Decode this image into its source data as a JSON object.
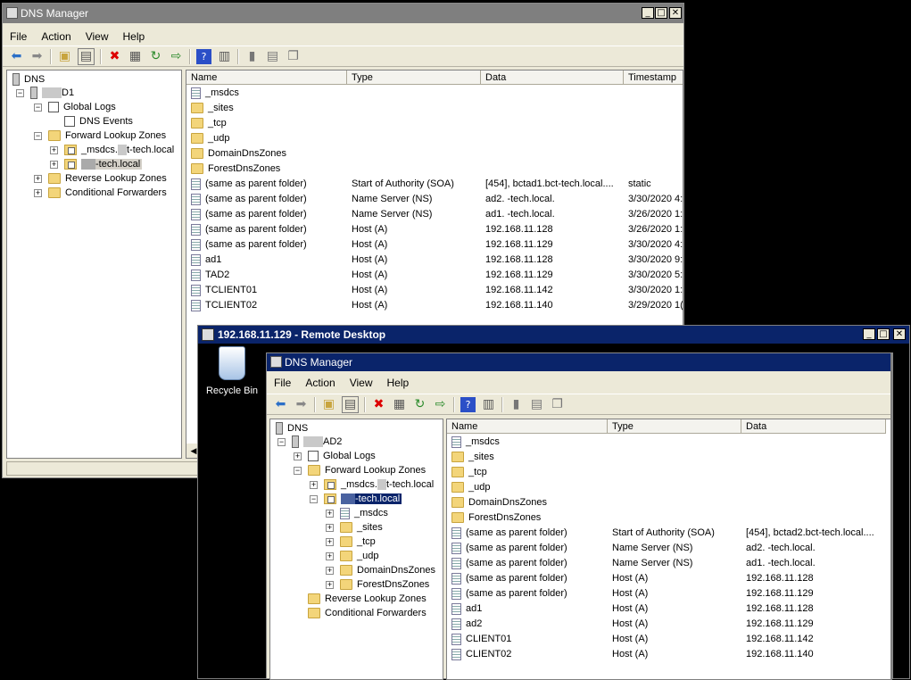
{
  "windowA": {
    "title": "DNS Manager",
    "menu": [
      "File",
      "Action",
      "View",
      "Help"
    ],
    "tree": {
      "root": "DNS",
      "server": "D1",
      "global_logs": "Global Logs",
      "dns_events": "DNS Events",
      "forward": "Forward Lookup Zones",
      "msdcs": "_msdcs.",
      "msdcs_suffix": "t-tech.local",
      "zone": "-tech.local",
      "reverse": "Reverse Lookup Zones",
      "conditional": "Conditional Forwarders"
    },
    "columns": [
      "Name",
      "Type",
      "Data",
      "Timestamp"
    ],
    "rows": [
      {
        "name": "_msdcs",
        "type": "",
        "data": "",
        "ts": "",
        "icon": "doc"
      },
      {
        "name": "_sites",
        "type": "",
        "data": "",
        "ts": "",
        "icon": "folder"
      },
      {
        "name": "_tcp",
        "type": "",
        "data": "",
        "ts": "",
        "icon": "folder"
      },
      {
        "name": "_udp",
        "type": "",
        "data": "",
        "ts": "",
        "icon": "folder"
      },
      {
        "name": "DomainDnsZones",
        "type": "",
        "data": "",
        "ts": "",
        "icon": "folder"
      },
      {
        "name": "ForestDnsZones",
        "type": "",
        "data": "",
        "ts": "",
        "icon": "folder"
      },
      {
        "name": "(same as parent folder)",
        "type": "Start of Authority (SOA)",
        "data": "[454], bctad1.bct-tech.local....",
        "ts": "static",
        "icon": "rec"
      },
      {
        "name": "(same as parent folder)",
        "type": "Name Server (NS)",
        "data": "ad2.    -tech.local.",
        "ts": "3/30/2020 4:",
        "icon": "rec"
      },
      {
        "name": "(same as parent folder)",
        "type": "Name Server (NS)",
        "data": "ad1.    -tech.local.",
        "ts": "3/26/2020 1:",
        "icon": "rec"
      },
      {
        "name": "(same as parent folder)",
        "type": "Host (A)",
        "data": "192.168.11.128",
        "ts": "3/26/2020 1:",
        "icon": "rec"
      },
      {
        "name": "(same as parent folder)",
        "type": "Host (A)",
        "data": "192.168.11.129",
        "ts": "3/30/2020 4:",
        "icon": "rec"
      },
      {
        "name": "ad1",
        "type": "Host (A)",
        "data": "192.168.11.128",
        "ts": "3/30/2020 9:",
        "icon": "rec"
      },
      {
        "name": "TAD2",
        "type": "Host (A)",
        "data": "192.168.11.129",
        "ts": "3/30/2020 5:",
        "icon": "rec"
      },
      {
        "name": "TCLIENT01",
        "type": "Host (A)",
        "data": "192.168.11.142",
        "ts": "3/30/2020 1:",
        "icon": "rec"
      },
      {
        "name": "TCLIENT02",
        "type": "Host (A)",
        "data": "192.168.11.140",
        "ts": "3/29/2020 1(",
        "icon": "rec"
      }
    ]
  },
  "rdp": {
    "title": "192.168.11.129 - Remote Desktop",
    "recycle_bin": "Recycle Bin"
  },
  "windowB": {
    "title": "DNS Manager",
    "menu": [
      "File",
      "Action",
      "View",
      "Help"
    ],
    "tree": {
      "root": "DNS",
      "server": "AD2",
      "global_logs": "Global Logs",
      "forward": "Forward Lookup Zones",
      "msdcs": "_msdcs.",
      "msdcs_suffix": "t-tech.local",
      "zone": "-tech.local",
      "z_msdcs": "_msdcs",
      "z_sites": "_sites",
      "z_tcp": "_tcp",
      "z_udp": "_udp",
      "z_domain": "DomainDnsZones",
      "z_forest": "ForestDnsZones",
      "reverse": "Reverse Lookup Zones",
      "conditional": "Conditional Forwarders"
    },
    "columns": [
      "Name",
      "Type",
      "Data"
    ],
    "rows": [
      {
        "name": "_msdcs",
        "type": "",
        "data": "",
        "icon": "doc"
      },
      {
        "name": "_sites",
        "type": "",
        "data": "",
        "icon": "folder"
      },
      {
        "name": "_tcp",
        "type": "",
        "data": "",
        "icon": "folder"
      },
      {
        "name": "_udp",
        "type": "",
        "data": "",
        "icon": "folder"
      },
      {
        "name": "DomainDnsZones",
        "type": "",
        "data": "",
        "icon": "folder"
      },
      {
        "name": "ForestDnsZones",
        "type": "",
        "data": "",
        "icon": "folder"
      },
      {
        "name": "(same as parent folder)",
        "type": "Start of Authority (SOA)",
        "data": "[454], bctad2.bct-tech.local....",
        "icon": "rec"
      },
      {
        "name": "(same as parent folder)",
        "type": "Name Server (NS)",
        "data": "ad2.    -tech.local.",
        "icon": "rec"
      },
      {
        "name": "(same as parent folder)",
        "type": "Name Server (NS)",
        "data": "ad1.    -tech.local.",
        "icon": "rec"
      },
      {
        "name": "(same as parent folder)",
        "type": "Host (A)",
        "data": "192.168.11.128",
        "icon": "rec"
      },
      {
        "name": "(same as parent folder)",
        "type": "Host (A)",
        "data": "192.168.11.129",
        "icon": "rec"
      },
      {
        "name": "ad1",
        "type": "Host (A)",
        "data": "192.168.11.128",
        "icon": "rec"
      },
      {
        "name": "ad2",
        "type": "Host (A)",
        "data": "192.168.11.129",
        "icon": "rec"
      },
      {
        "name": "CLIENT01",
        "type": "Host (A)",
        "data": "192.168.11.142",
        "icon": "rec"
      },
      {
        "name": "CLIENT02",
        "type": "Host (A)",
        "data": "192.168.11.140",
        "icon": "rec"
      }
    ]
  },
  "colors": {
    "titlebar_active": "#0a246a",
    "titlebar_inactive": "#7f7f7f",
    "accent": "#0a246a"
  },
  "toolbar_icons": [
    "back-icon",
    "forward-icon",
    "up-folder-icon",
    "show-hide-tree-icon",
    "delete-icon",
    "properties-icon",
    "refresh-icon",
    "export-list-icon",
    "help-icon",
    "console-icon",
    "server-icon",
    "list-icon",
    "copy-icon"
  ]
}
